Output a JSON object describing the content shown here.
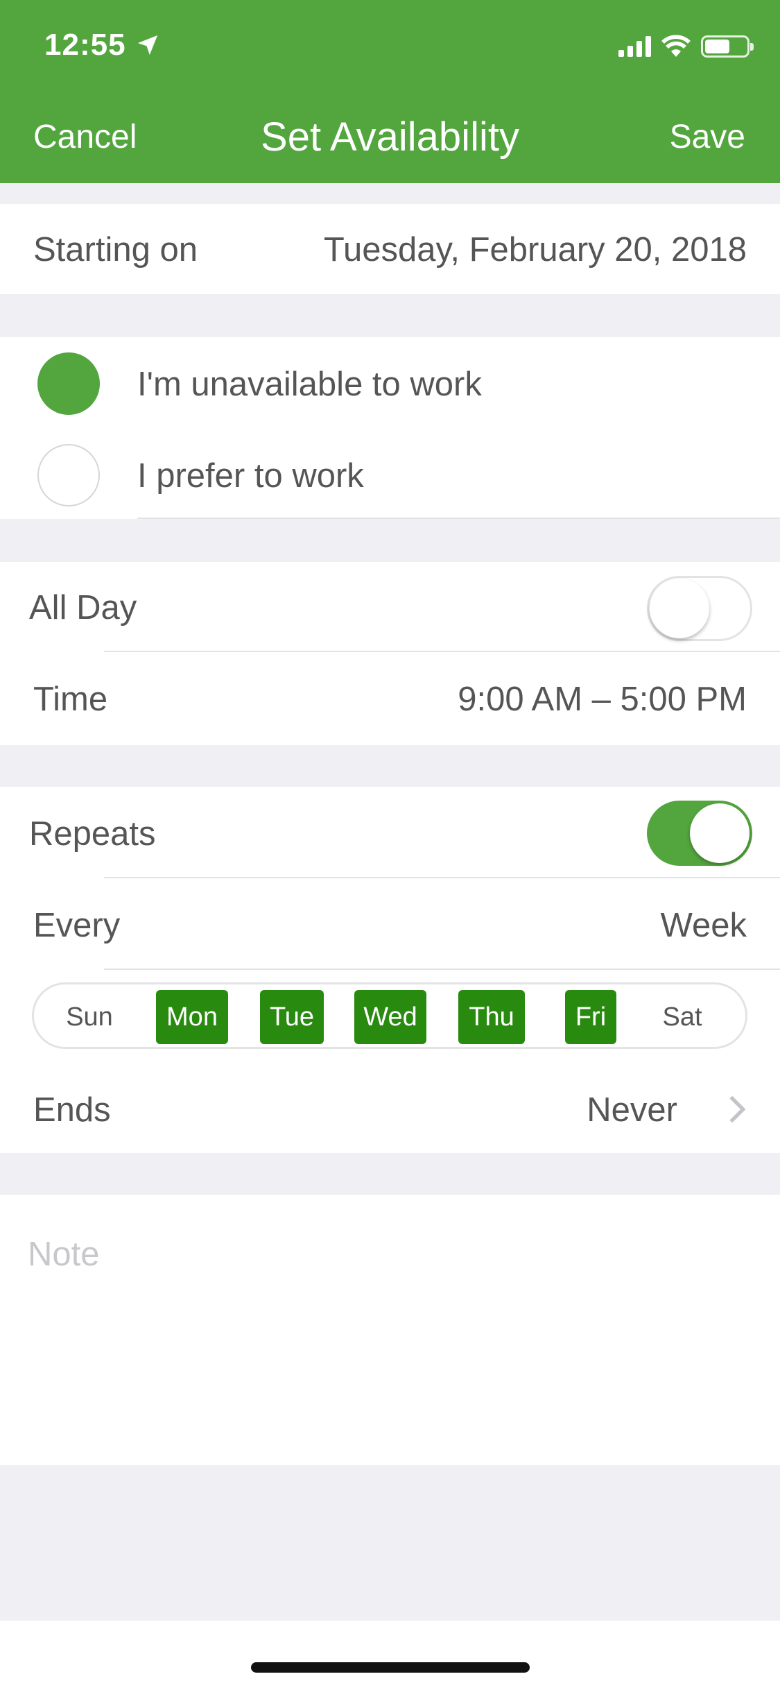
{
  "status_bar": {
    "time": "12:55",
    "icons": [
      "location-arrow-icon",
      "cellular-signal-icon",
      "wifi-icon",
      "battery-icon"
    ]
  },
  "nav": {
    "cancel_label": "Cancel",
    "title": "Set Availability",
    "save_label": "Save"
  },
  "starting_on": {
    "label": "Starting on",
    "value": "Tuesday, February 20, 2018"
  },
  "availability_type": {
    "options": [
      {
        "label": "I'm unavailable to work",
        "selected": true
      },
      {
        "label": "I prefer to work",
        "selected": false
      }
    ]
  },
  "all_day": {
    "label": "All Day",
    "enabled": false
  },
  "time": {
    "label": "Time",
    "value": "9:00 AM – 5:00 PM"
  },
  "repeats": {
    "label": "Repeats",
    "enabled": true
  },
  "every": {
    "label": "Every",
    "value": "Week"
  },
  "days": [
    {
      "label": "Sun",
      "selected": false
    },
    {
      "label": "Mon",
      "selected": true
    },
    {
      "label": "Tue",
      "selected": true
    },
    {
      "label": "Wed",
      "selected": true
    },
    {
      "label": "Thu",
      "selected": true
    },
    {
      "label": "Fri",
      "selected": true
    },
    {
      "label": "Sat",
      "selected": false
    }
  ],
  "ends": {
    "label": "Ends",
    "value": "Never"
  },
  "note": {
    "placeholder": "Note"
  },
  "colors": {
    "brand_green": "#53a53e",
    "selected_day_green": "#288a0f",
    "background_gray": "#efeff4"
  }
}
